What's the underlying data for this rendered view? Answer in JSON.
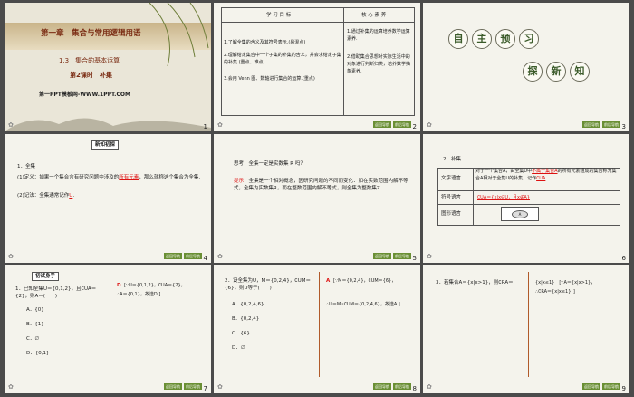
{
  "slides": [
    {
      "number": "1",
      "chapter": "第一章　集合与常用逻辑用语",
      "section": "1.3　集合的基本运算",
      "lesson": "第2课时　补集",
      "watermark": "第一PPT模板网-WWW.1PPT.COM"
    },
    {
      "number": "2",
      "col1": "学 习 目 标",
      "col2": "核 心 素 养",
      "goals": [
        "1.了解全集的含义及其符号表示.(易混点)",
        "2.理解给定集合中一个子集的补集的含义，并会求给定子集的补集.(重点、难点)",
        "3.会用 Venn 图、数轴进行集合的运算.(重点)"
      ],
      "literacy": [
        "1.通过补集的运算培养数学运算素养.",
        "2.借助集合思想对实际生活中的对象进行判断归类，培养数学抽象素养."
      ]
    },
    {
      "number": "3",
      "title_chars": [
        "自",
        "主",
        "预",
        "习"
      ],
      "sub_chars": [
        "探",
        "新",
        "知"
      ]
    },
    {
      "number": "4",
      "tag": "新知初探",
      "heading": "1．全集",
      "def_pre": "(1)定义：如果一个集合含有研究问题中涉及的",
      "def_blank": "所有元素",
      "def_post": "，那么就称这个集合为全集.",
      "note_pre": "(2)记法：全集通常记作",
      "note_blank": "U",
      "note_post": "."
    },
    {
      "number": "5",
      "question": "思考：全集一定是实数集 R 吗？",
      "hint_label": "提示：",
      "hint": "全集是一个相对概念，因研究问题的不同而变化．如在实数范围内解不等式，全集为实数集R，而在整数范围内解不等式，则全集为整数集Z."
    },
    {
      "number": "6",
      "heading": "2．补集",
      "row1_label": "文字语言",
      "row1_pre": "对于一个集合A，由全集U中",
      "row1_blank": "不属于集合A",
      "row1_post": "的所有元素组成的集合称为集合A相对于全集U的补集，记作",
      "row1_symbol": "∁UA",
      "row2_label": "符号语言",
      "row2_value": "∁UA＝{x|x∈U，且x∉A}",
      "row3_label": "图形语言",
      "venn_A": "A"
    },
    {
      "number": "7",
      "tag": "初试身手",
      "q": "1．已知全集U＝{0,1,2}，且∁UA＝{2}，则A＝(　　)",
      "opts": [
        "A．{0}",
        "B．{1}",
        "C．∅",
        "D．{0,1}"
      ],
      "ans": "D",
      "expl1": "[∵U＝{0,1,2}，∁UA＝{2}，",
      "expl2": "∴A＝{0,1}，故选D.]"
    },
    {
      "number": "8",
      "q1": "2．设全集为U，M＝{0,2,4}，∁UM＝{6}，则U等于(　　)",
      "opts": [
        "A．{0,2,4,6}",
        "B．{0,2,4}",
        "C．{6}",
        "D．∅"
      ],
      "ans": "A",
      "expl1": "[∵M＝{0,2,4}，∁UM＝{6}，",
      "expl2": "∴U＝M∪∁UM＝{0,2,4,6}，故选A.]"
    },
    {
      "number": "9",
      "q": "3．若集合A＝{x|x>1}，则∁RA＝",
      "expl1": "{x|x≤1}　[∵A＝{x|x>1}，",
      "expl2": "∴∁RA＝{x|x≤1}．]"
    }
  ],
  "nav": {
    "prev": "返回导航",
    "next": "前后导航"
  }
}
